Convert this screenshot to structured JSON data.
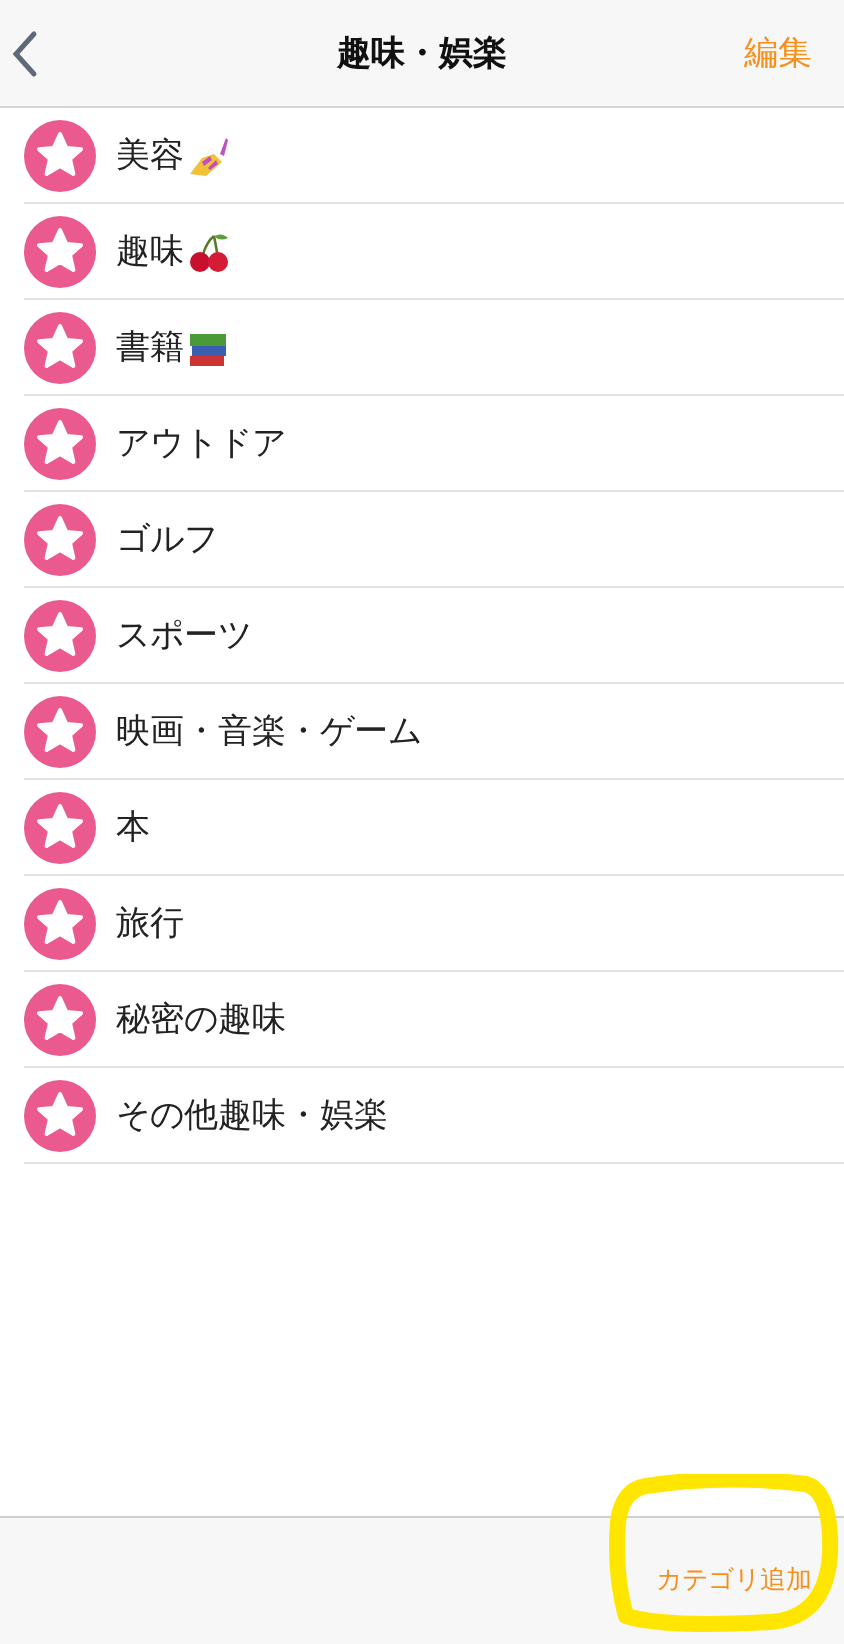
{
  "nav_bar": {
    "title": "趣味・娯楽",
    "edit": "編集"
  },
  "categories": [
    {
      "label": "美容",
      "kind": "nail_polish"
    },
    {
      "label": "趣味",
      "kind": "cherry"
    },
    {
      "label": "書籍",
      "kind": "books"
    },
    {
      "label": "アウトドア"
    },
    {
      "label": "ゴルフ"
    },
    {
      "label": "スポーツ"
    },
    {
      "label": "映画・音楽・ゲーム"
    },
    {
      "label": "本"
    },
    {
      "label": "旅行"
    },
    {
      "label": "秘密の趣味"
    },
    {
      "label": "その他趣味・娯楽"
    }
  ],
  "bottom_bar": {
    "add_button": "カテゴリ追加",
    "annotation": {
      "kind": "highlight_circle"
    }
  }
}
